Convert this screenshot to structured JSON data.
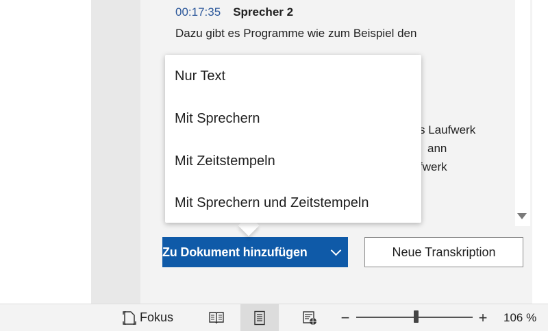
{
  "transcript": {
    "entry": {
      "timestamp": "00:17:35",
      "speaker": "Sprecher 2",
      "text": "Dazu gibt es Programme wie zum Beispiel den"
    },
    "visible_fragments": [
      "s Laufwerk",
      "ann",
      "fwerk"
    ]
  },
  "insert_menu": {
    "items": [
      {
        "label": "Nur Text"
      },
      {
        "label": "Mit Sprechern"
      },
      {
        "label": "Mit Zeitstempeln"
      },
      {
        "label": "Mit Sprechern und Zeitstempeln"
      }
    ]
  },
  "actions": {
    "add_to_document": "Zu Dokument hinzufügen",
    "new_transcription": "Neue Transkription"
  },
  "statusbar": {
    "focus_label": "Fokus",
    "zoom_percent": "106 %",
    "zoom_minus": "−",
    "zoom_plus": "+",
    "zoom_level_fraction": 0.5
  },
  "colors": {
    "accent": "#0f5aa8",
    "timestamp": "#2b579a"
  }
}
